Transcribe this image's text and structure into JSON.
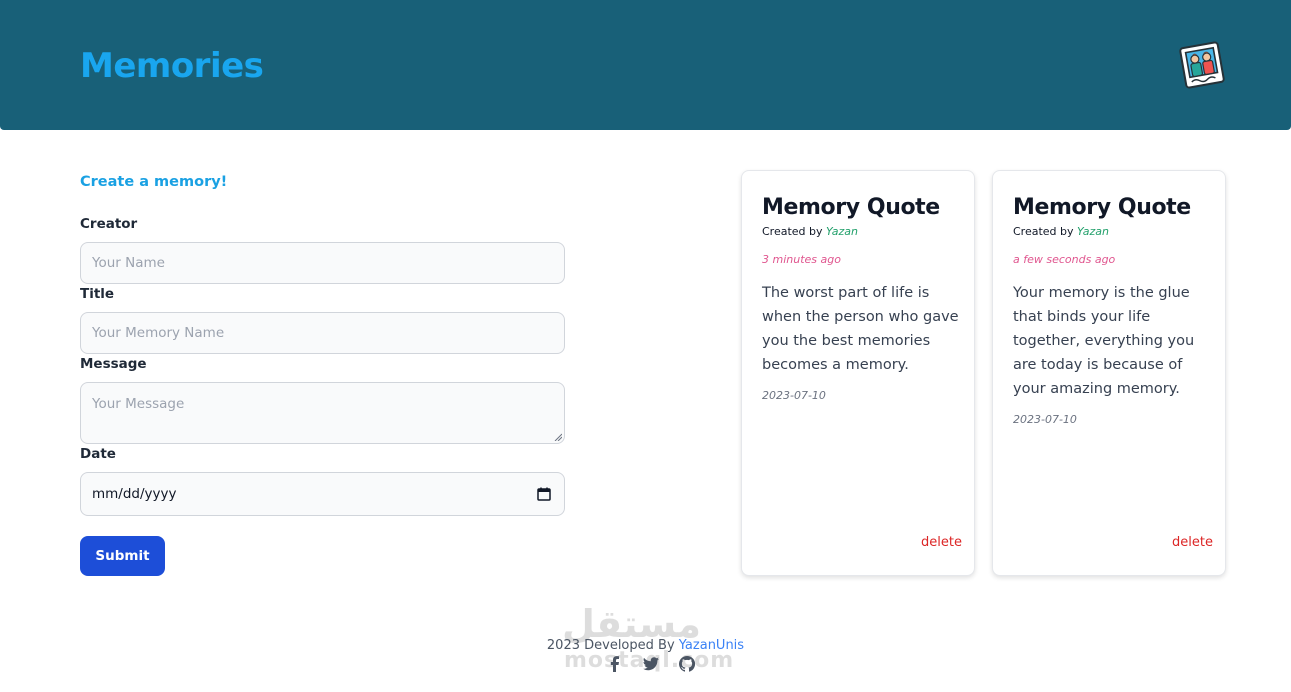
{
  "header": {
    "title": "Memories",
    "logo_icon": "photo-memories-icon",
    "background": "#186078",
    "title_color": "#19a6ef"
  },
  "form": {
    "heading": "Create a memory!",
    "creator_label": "Creator",
    "creator_placeholder": "Your Name",
    "title_label": "Title",
    "title_placeholder": "Your Memory Name",
    "message_label": "Message",
    "message_placeholder": "Your Message",
    "date_label": "Date",
    "date_value": "mm/dd/yyyy",
    "submit_label": "Submit"
  },
  "cards": [
    {
      "title": "Memory Quote",
      "created_by_prefix": "Created by",
      "author": "Yazan",
      "time_ago": "3 minutes ago",
      "message": "The worst part of life is when the person who gave you the best memories becomes a memory.",
      "date": "2023-07-10",
      "delete_label": "delete"
    },
    {
      "title": "Memory Quote",
      "created_by_prefix": "Created by",
      "author": "Yazan",
      "time_ago": "a few seconds ago",
      "message": "Your memory is the glue that binds your life together, everything you are today is because of your amazing memory.",
      "date": "2023-07-10",
      "delete_label": "delete"
    }
  ],
  "footer": {
    "text": "2023 Developed By",
    "author_link": "YazanUnis",
    "social_icons": [
      "facebook-icon",
      "twitter-icon",
      "github-icon"
    ]
  },
  "watermark": {
    "arabic": "مستقل",
    "latin": "mostaql.com"
  }
}
